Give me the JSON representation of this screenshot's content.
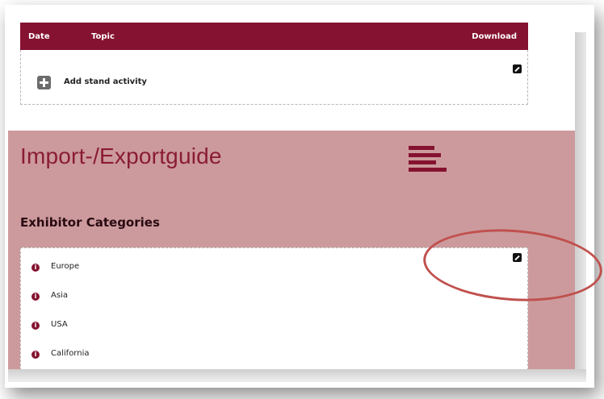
{
  "table": {
    "headers": {
      "date": "Date",
      "topic": "Topic",
      "download": "Download"
    }
  },
  "stand_activity": {
    "add_label": "Add stand activity"
  },
  "section": {
    "title": "Import-/Exportguide",
    "subtitle": "Exhibitor Categories",
    "categories": [
      {
        "label": "Europe"
      },
      {
        "label": "Asia"
      },
      {
        "label": "USA"
      },
      {
        "label": "California"
      }
    ]
  },
  "icons": {
    "plus": "plus-icon",
    "edit": "pencil-icon",
    "menu": "hamburger-menu-icon",
    "info": "info-icon",
    "info_glyph": "i"
  },
  "colors": {
    "brand": "#851230",
    "section_bg": "#cc9a9c",
    "annotation": "#c0504d"
  }
}
